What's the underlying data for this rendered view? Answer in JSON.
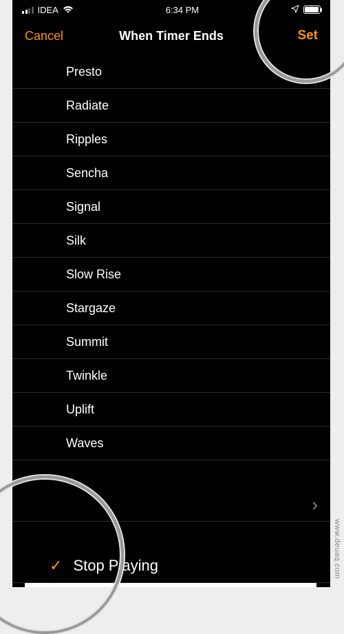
{
  "status_bar": {
    "carrier": "IDEA",
    "time": "6:34 PM"
  },
  "nav": {
    "cancel": "Cancel",
    "title": "When Timer Ends",
    "set": "Set"
  },
  "sounds": [
    "Presto",
    "Radiate",
    "Ripples",
    "Sencha",
    "Signal",
    "Silk",
    "Slow Rise",
    "Stargaze",
    "Summit",
    "Twinkle",
    "Uplift",
    "Waves"
  ],
  "disclosure_row": "",
  "stop_playing": "Stop Playing",
  "watermark": "www.deuaq.com",
  "accent": "#FF9500"
}
